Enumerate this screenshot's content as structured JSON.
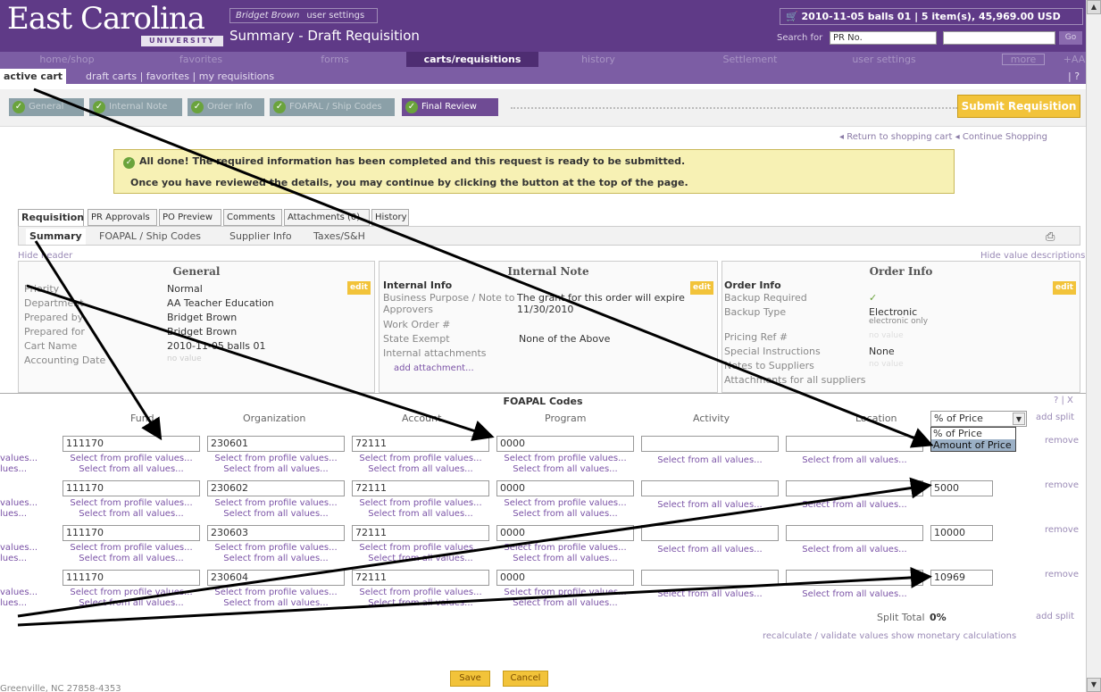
{
  "header": {
    "logo": "East Carolina",
    "logo_sub": "UNIVERSITY",
    "user_name": "Bridget Brown",
    "user_settings": "user settings",
    "page_title": "Summary - Draft Requisition",
    "cart": "2010-11-05 balls 01 | 5 item(s), 45,969.00 USD",
    "search_label": "Search for",
    "search_option": "PR No.",
    "go": "Go"
  },
  "nav": [
    "home/shop",
    "favorites",
    "forms",
    "carts/requisitions",
    "history",
    "Settlement",
    "user settings",
    "more >>",
    "+AA"
  ],
  "subnav": {
    "active": "active cart",
    "others": "draft carts  |  favorites  |  my requisitions",
    "help": "| ?"
  },
  "steps": [
    "General",
    "Internal Note",
    "Order Info",
    "FOAPAL / Ship Codes",
    "Final Review"
  ],
  "submit": "Submit Requisition",
  "links": {
    "return": "Return to shopping cart",
    "continue": "Continue Shopping"
  },
  "notice": {
    "l1": "All done! The required information has been completed and this request is ready to be submitted.",
    "l2": "Once you have reviewed the details, you may continue by clicking the button at the top of the page."
  },
  "rtabs": [
    "Requisition",
    "PR Approvals",
    "PO Preview",
    "Comments",
    "Attachments (0)",
    "History"
  ],
  "subtabs": [
    "Summary",
    "FOAPAL / Ship Codes",
    "Supplier Info",
    "Taxes/S&H"
  ],
  "hide_header": "Hide header",
  "hide_values": "Hide value descriptions",
  "general": {
    "title": "General",
    "edit": "edit",
    "rows": [
      [
        "Priority",
        "Normal"
      ],
      [
        "Department",
        "AA Teacher Education"
      ],
      [
        "Prepared by",
        "Bridget Brown"
      ],
      [
        "Prepared for",
        "Bridget Brown"
      ],
      [
        "Cart Name",
        "2010-11-05 balls 01"
      ],
      [
        "Accounting Date",
        "no value"
      ]
    ]
  },
  "internal": {
    "title": "Internal Note",
    "edit": "edit",
    "head": "Internal Info",
    "bp": "Business Purpose / Note to Approvers",
    "bp_val": "The grant for this order will expire 11/30/2010",
    "wo": "Work Order #",
    "se": "State Exempt",
    "se_val": "None of the Above",
    "ia": "Internal attachments",
    "add": "add attachment..."
  },
  "order": {
    "title": "Order Info",
    "edit": "edit",
    "head": "Order Info",
    "br": "Backup Required",
    "br_val": "✓",
    "bt": "Backup Type",
    "bt_val": "Electronic",
    "bt_sub": "electronic only",
    "pr": "Pricing Ref #",
    "pr_val": "no value",
    "si": "Special Instructions",
    "si_val": "None",
    "ns": "Notes to Suppliers",
    "ns_val": "no value",
    "as": "Attachments for all suppliers"
  },
  "modal": {
    "title": "FOAPAL Codes",
    "tools": "? | X",
    "cols": [
      "Fund",
      "Organization",
      "Account",
      "Program",
      "Activity",
      "Location"
    ],
    "pct_label": "% of Price",
    "options": [
      "% of Price",
      "Amount of Price"
    ],
    "add_split": "add split",
    "remove": "remove",
    "profile": "Select from profile values...",
    "all": "Select from all values...",
    "left_a": "values...",
    "left_b": "lues...",
    "rows": [
      {
        "fund": "111170",
        "org": "230601",
        "acct": "72111",
        "prog": "0000",
        "amt": ""
      },
      {
        "fund": "111170",
        "org": "230602",
        "acct": "72111",
        "prog": "0000",
        "amt": "5000"
      },
      {
        "fund": "111170",
        "org": "230603",
        "acct": "72111",
        "prog": "0000",
        "amt": "10000"
      },
      {
        "fund": "111170",
        "org": "230604",
        "acct": "72111",
        "prog": "0000",
        "amt": "10969"
      }
    ],
    "split_label": "Split Total",
    "split_val": "0%",
    "recalc": "recalculate / validate values   show monetary calculations",
    "save": "Save",
    "cancel": "Cancel"
  },
  "footer": "Greenville, NC 27858-4353"
}
